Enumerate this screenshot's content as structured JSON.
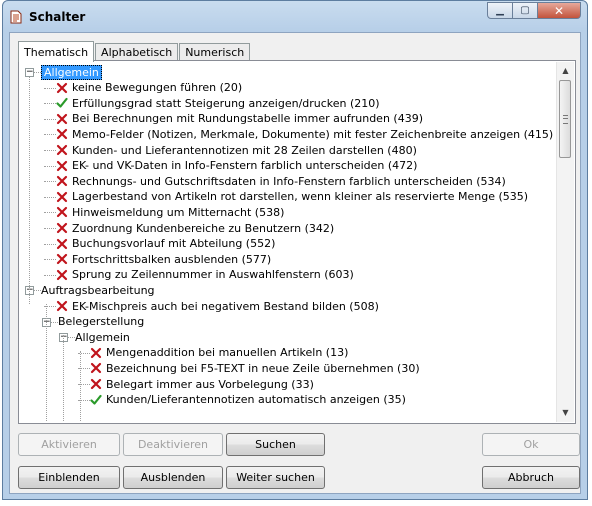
{
  "window": {
    "title": "Schalter"
  },
  "tabs": [
    {
      "label": "Thematisch",
      "active": true
    },
    {
      "label": "Alphabetisch",
      "active": false
    },
    {
      "label": "Numerisch",
      "active": false
    }
  ],
  "tree": {
    "groups": [
      {
        "label": "Allgemein",
        "selected": true,
        "expanded": true
      },
      {
        "label": "Auftragsbearbeitung",
        "expanded": true
      },
      {
        "label": "Belegerstellung",
        "expanded": true
      },
      {
        "label": "Allgemein",
        "expanded": true
      }
    ],
    "items": [
      {
        "label": "keine Bewegungen führen (20)",
        "state": "off"
      },
      {
        "label": "Erfüllungsgrad statt Steigerung anzeigen/drucken (210)",
        "state": "on"
      },
      {
        "label": "Bei Berechnungen mit Rundungstabelle immer aufrunden (439)",
        "state": "off"
      },
      {
        "label": "Memo-Felder (Notizen, Merkmale, Dokumente) mit fester Zeichenbreite anzeigen (415)",
        "state": "off"
      },
      {
        "label": "Kunden- und Lieferantennotizen mit 28 Zeilen darstellen (480)",
        "state": "off"
      },
      {
        "label": "EK- und VK-Daten in Info-Fenstern farblich unterscheiden (472)",
        "state": "off"
      },
      {
        "label": "Rechnungs- und Gutschriftsdaten in Info-Fenstern farblich unterscheiden (534)",
        "state": "off"
      },
      {
        "label": "Lagerbestand von Artikeln rot darstellen, wenn kleiner als reservierte Menge (535)",
        "state": "off"
      },
      {
        "label": "Hinweismeldung um Mitternacht (538)",
        "state": "off"
      },
      {
        "label": "Zuordnung Kundenbereiche zu Benutzern (342)",
        "state": "off"
      },
      {
        "label": "Buchungsvorlauf mit Abteilung (552)",
        "state": "off"
      },
      {
        "label": "Fortschrittsbalken ausblenden (577)",
        "state": "off"
      },
      {
        "label": "Sprung zu Zeilennummer in Auswahlfenstern (603)",
        "state": "off"
      },
      {
        "label": "EK-Mischpreis auch bei negativem Bestand bilden (508)",
        "state": "off"
      },
      {
        "label": "Mengenaddition bei manuellen Artikeln (13)",
        "state": "off"
      },
      {
        "label": "Bezeichnung bei F5-TEXT in neue Zeile übernehmen (30)",
        "state": "off"
      },
      {
        "label": "Belegart immer aus Vorbelegung (33)",
        "state": "off"
      },
      {
        "label": "Kunden/Lieferantennotizen automatisch anzeigen (35)",
        "state": "on"
      }
    ]
  },
  "buttons": {
    "aktivieren": "Aktivieren",
    "deaktivieren": "Deaktivieren",
    "suchen": "Suchen",
    "ok": "Ok",
    "einblenden": "Einblenden",
    "ausblenden": "Ausblenden",
    "weiter_suchen": "Weiter suchen",
    "abbruch": "Abbruch"
  },
  "colors": {
    "on": "#2a9a2a",
    "off": "#c0141c",
    "selection": "#3399ff"
  }
}
